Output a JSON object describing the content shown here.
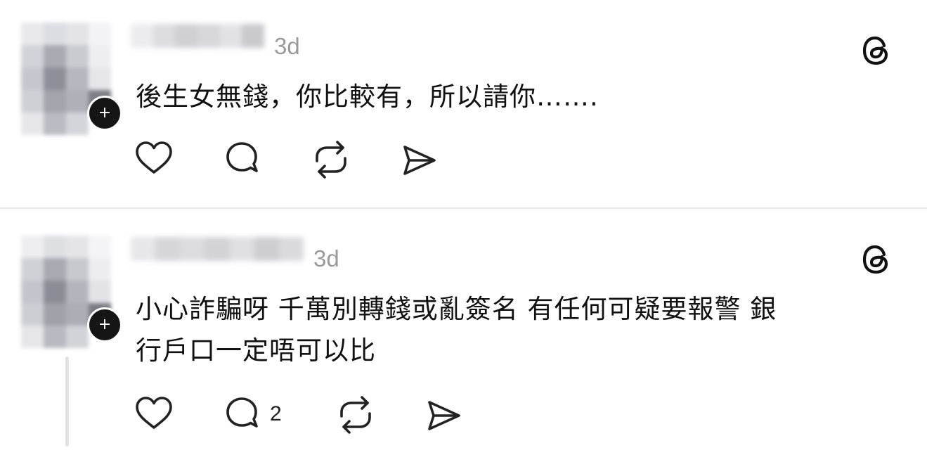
{
  "posts": [
    {
      "timestamp": "3d",
      "text_lines": [
        "後生女無錢，你比較有，所以請你……."
      ],
      "badge_glyph": "+",
      "actions": [
        "heart-icon",
        "comment-icon",
        "repost-icon",
        "share-icon"
      ],
      "reply_count": ""
    },
    {
      "timestamp": "3d",
      "text_lines": [
        "小心詐騙呀 千萬別轉錢或亂簽名 有任何可疑要報警 銀",
        "行戶口一定唔可以比"
      ],
      "badge_glyph": "+",
      "actions": [
        "heart-icon",
        "comment-icon",
        "repost-icon",
        "share-icon"
      ],
      "reply_count": "2"
    }
  ],
  "colors": {
    "text": "#111111",
    "muted": "#9a9a9a",
    "divider": "#e6e6e6",
    "icon": "#222222"
  }
}
